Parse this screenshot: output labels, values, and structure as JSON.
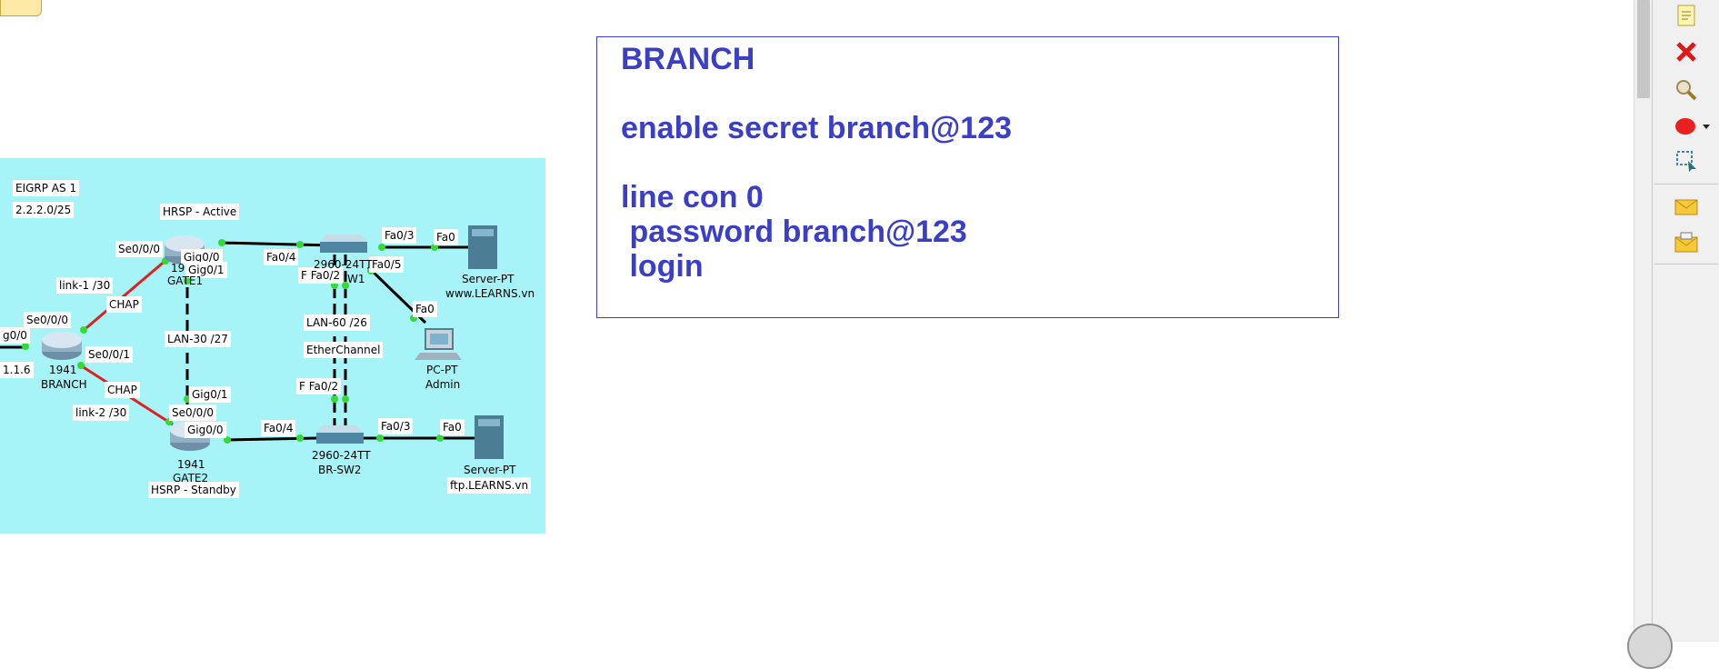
{
  "labels": {
    "eigrp": "EIGRP AS 1",
    "network": "2.2.2.0/25",
    "hrsp_active": "HRSP - Active",
    "gate1_se000": "Se0/0/0",
    "gate1_gig00": "Gig0/0",
    "gate1_gig01": "Gig0/1",
    "gate1_model": "19",
    "gate1_name": "GATE1",
    "link1": "link-1 /30",
    "chap1": "CHAP",
    "branch_se000": "Se0/0/0",
    "branch_se001": "Se0/0/1",
    "branch_gig00": "g0/0",
    "branch_ip": "1.1.6",
    "branch_model": "1941",
    "branch_name": "BRANCH",
    "chap2": "CHAP",
    "link2": "link-2 /30",
    "lan30": "LAN-30 /27",
    "gate2_gig01": "Gig0/1",
    "gate2_se000": "Se0/0/0",
    "gate2_gig00": "Gig0/0",
    "gate2_model": "1941",
    "gate2_name": "GATE2",
    "hsrp_standby": "HSRP - Standby",
    "sw1_fa04": "Fa0/4",
    "sw1_fa03": "Fa0/3",
    "sw1_fa05": "Fa0/5",
    "sw1_fa02": "F Fa0/2",
    "sw1_model": "2960-24TT",
    "sw1_name": "W1",
    "web_fa0": "Fa0",
    "web_type": "Server-PT",
    "web_name": "www.LEARNS.vn",
    "pc_fa0": "Fa0",
    "pc_type": "PC-PT",
    "pc_name": "Admin",
    "lan60": "LAN-60 /26",
    "etherchannel": "EtherChannel",
    "sw2_fa02": "F Fa0/2",
    "sw2_fa04": "Fa0/4",
    "sw2_fa03": "Fa0/3",
    "sw2_model": "2960-24TT",
    "sw2_name": "BR-SW2",
    "ftp_fa0": "Fa0",
    "ftp_type": "Server-PT",
    "ftp_name": "ftp.LEARNS.vn"
  },
  "note": {
    "lines": [
      "BRANCH",
      "",
      "enable secret branch@123",
      "",
      "line con 0",
      " password branch@123",
      " login"
    ]
  },
  "toolbar": {
    "tools": [
      "select-note-icon",
      "delete-icon",
      "inspect-icon",
      "draw-ellipse-icon",
      "resize-select-icon",
      "simple-pdu-icon",
      "complex-pdu-icon"
    ]
  },
  "colors": {
    "topology_bg": "#a6f4f7",
    "note_text": "#3b3fc7",
    "serial_link": "#e02020",
    "ethernet_link": "#000000",
    "port_up": "#36d936"
  }
}
